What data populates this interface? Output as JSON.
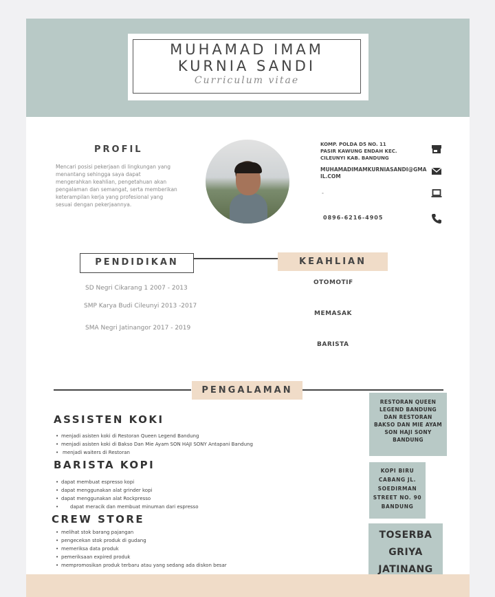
{
  "header": {
    "name_line1": "MUHAMAD IMAM",
    "name_line2": "KURNIA SANDI",
    "subtitle": "Curriculum vitae"
  },
  "profile": {
    "heading": "PROFIL",
    "text": "Mencari posisi pekerjaan di lingkungan yang menantang sehingga saya dapat mengerahkan keahlian, pengetahuan akan pengalaman dan semangat, serta memberikan keterampilan kerja yang profesional yang sesuai dengan pekerjaannya."
  },
  "contact": {
    "address": "KOMP. POLDA D5 NO. 11 PASIR KAWUNG ENDAH KEC. CILEUNYI KAB. BANDUNG",
    "email": "MUHAMADIMAMKURNIASANDI@GMAIL.COM",
    "website": "-",
    "phone": "0896-6216-4905",
    "icons": [
      "store-icon",
      "mail-icon",
      "laptop-icon",
      "phone-icon"
    ]
  },
  "education": {
    "heading": "PENDIDIKAN",
    "items": [
      "SD Negri Cikarang 1 2007 - 2013",
      "SMP Karya Budi Cileunyi 2013 -2017",
      "SMA Negri Jatinangor 2017 - 2019"
    ]
  },
  "skills": {
    "heading": "KEAHLIAN",
    "items": [
      "OTOMOTIF",
      "MEMASAK",
      "BARISTA"
    ]
  },
  "experience": {
    "heading": "PENGALAMAN",
    "jobs": [
      {
        "title": "ASSISTEN KOKI",
        "duties": [
          "menjadi asisten koki di Restoran Queen Legend Bandung",
          "menjadi asisten koki di Bakso Dan Mie Ayam SON HAJI SONY Antapani Bandung",
          "menjadi waiters di Restoran"
        ],
        "place": "RESTORAN QUEEN LEGEND BANDUNG DAN RESTORAN BAKSO DAN MIE AYAM SON HAJI SONY BANDUNG"
      },
      {
        "title": "BARISTA KOPI",
        "duties": [
          "dapat membuat espresso kopi",
          "dapat menggunakan alat grinder kopi",
          "dapat menggunakan alat Rockpresso",
          "dapat meracik dan membuat minuman dari espresso"
        ],
        "place": "KOPI BIRU CABANG JL. SOEDIRMAN STREET NO. 90 BANDUNG"
      },
      {
        "title": "CREW STORE",
        "duties": [
          "melihat stok barang pajangan",
          "pengecekan stok produk di gudang",
          "memeriksa data produk",
          "pemeriksaan expired produk",
          "mempromosikan produk terbaru atau yang sedang ada diskon besar"
        ],
        "place": "TOSERBA GRIYA JATINANG"
      }
    ]
  },
  "colors": {
    "sage": "#b8c9c6",
    "peach": "#f0dcc8",
    "text": "#444444"
  }
}
